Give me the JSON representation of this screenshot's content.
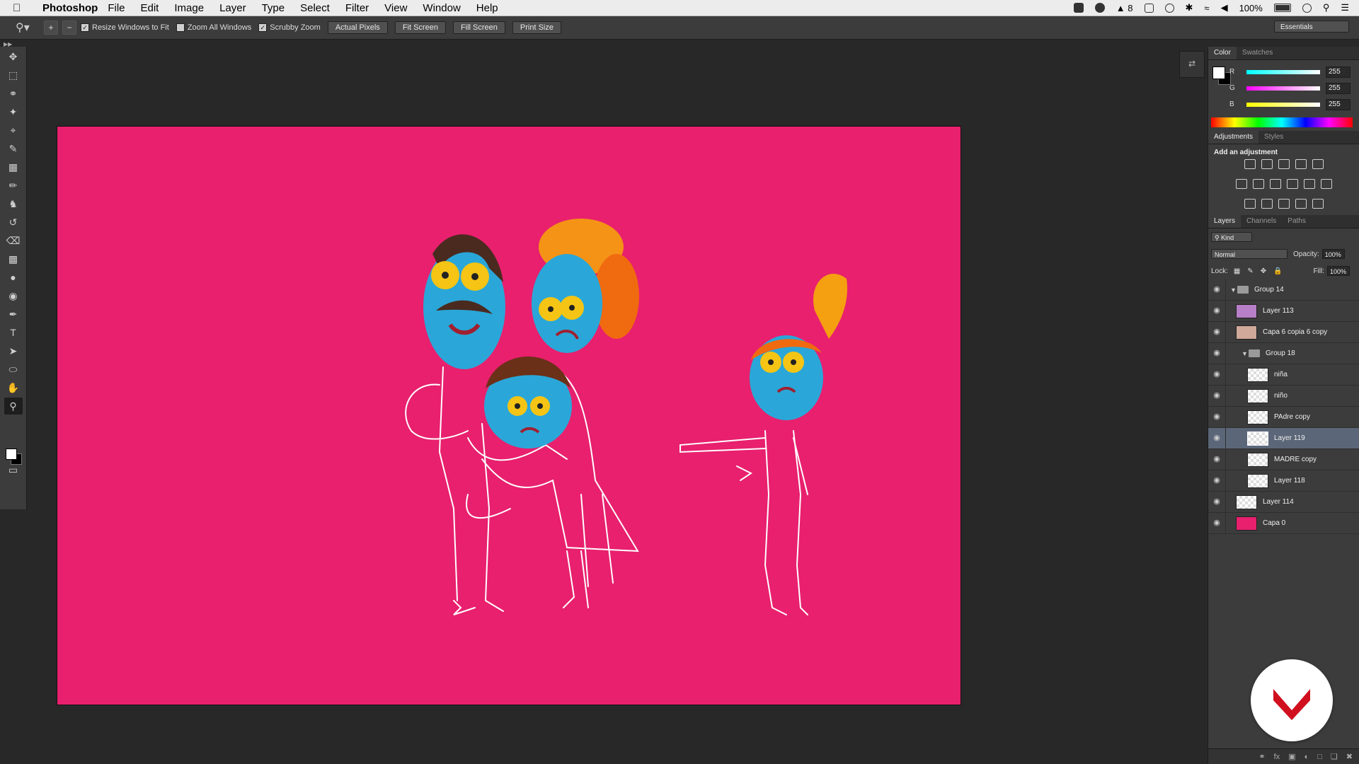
{
  "menubar": {
    "app": "Photoshop",
    "items": [
      "File",
      "Edit",
      "Image",
      "Layer",
      "Type",
      "Select",
      "Filter",
      "View",
      "Window",
      "Help"
    ],
    "adobe_count": "8",
    "battery": "100%"
  },
  "options": {
    "resize_windows": "Resize Windows to Fit",
    "zoom_all": "Zoom All Windows",
    "scrubby": "Scrubby Zoom",
    "actual_pixels": "Actual Pixels",
    "fit_screen": "Fit Screen",
    "fill_screen": "Fill Screen",
    "print_size": "Print Size",
    "workspace": "Essentials"
  },
  "color_panel": {
    "tabs": [
      "Color",
      "Swatches"
    ],
    "r": "255",
    "g": "255",
    "b": "255",
    "r_label": "R",
    "g_label": "G",
    "b_label": "B"
  },
  "adjustments": {
    "tabs": [
      "Adjustments",
      "Styles"
    ],
    "title": "Add an adjustment"
  },
  "layers": {
    "tabs": [
      "Layers",
      "Channels",
      "Paths"
    ],
    "kind": "Kind",
    "blend_mode": "Normal",
    "opacity_label": "Opacity:",
    "opacity": "100%",
    "lock_label": "Lock:",
    "fill_label": "Fill:",
    "fill": "100%",
    "rows": [
      {
        "name": "Group 14"
      },
      {
        "name": "Layer 113"
      },
      {
        "name": "Capa 6 copia 6 copy"
      },
      {
        "name": "Group 18"
      },
      {
        "name": "niña"
      },
      {
        "name": "niño"
      },
      {
        "name": "PAdre copy"
      },
      {
        "name": "Layer 119"
      },
      {
        "name": "MADRE copy"
      },
      {
        "name": "Layer 118"
      },
      {
        "name": "Layer 114"
      },
      {
        "name": "Capa 0"
      }
    ]
  },
  "colors": {
    "canvas": "#e8206e",
    "selected_layer": "#5b6678",
    "badge_logo": "#d0101e"
  }
}
